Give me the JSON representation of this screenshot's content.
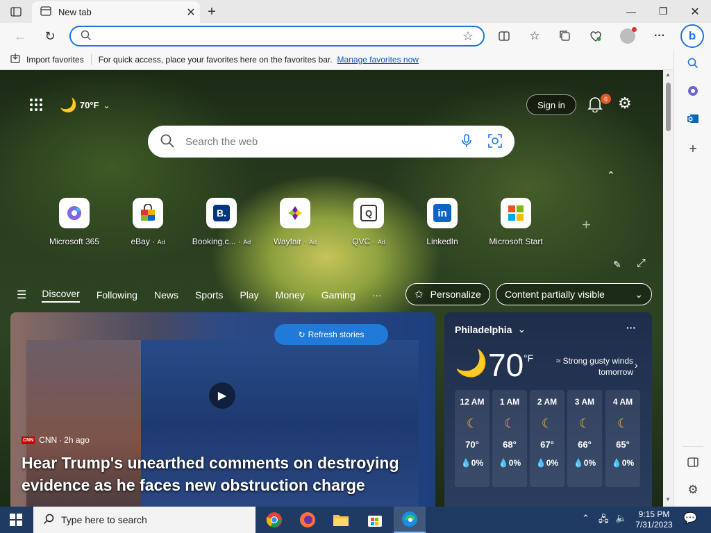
{
  "browser": {
    "tab_title": "New tab",
    "address_value": "",
    "favorites_bar": {
      "import_label": "Import favorites",
      "message": "For quick access, place your favorites here on the favorites bar.",
      "manage_link": "Manage favorites now"
    }
  },
  "newtab": {
    "weather_chip": "70°F",
    "sign_in": "Sign in",
    "notifications_count": "6",
    "search_placeholder": "Search the web",
    "quick_links": [
      {
        "label": "Microsoft 365",
        "ad": ""
      },
      {
        "label": "eBay",
        "ad": "Ad"
      },
      {
        "label": "Booking.c...",
        "ad": "Ad"
      },
      {
        "label": "Wayfair",
        "ad": "Ad"
      },
      {
        "label": "QVC",
        "ad": "Ad"
      },
      {
        "label": "LinkedIn",
        "ad": ""
      },
      {
        "label": "Microsoft Start",
        "ad": ""
      }
    ],
    "nav_tabs": [
      "Discover",
      "Following",
      "News",
      "Sports",
      "Play",
      "Money",
      "Gaming",
      "···"
    ],
    "personalize": "Personalize",
    "content_visibility": "Content partially visible",
    "hero": {
      "refresh": "Refresh stories",
      "source": "CNN",
      "age": "2h ago",
      "headline": "Hear Trump's unearthed comments on destroying evidence as he faces new obstruction charge"
    },
    "weather": {
      "city": "Philadelphia",
      "temp": "70",
      "unit": "°F",
      "forecast": "Strong gusty winds tomorrow",
      "hours": [
        {
          "hour": "12 AM",
          "temp": "70°",
          "precip": "0%"
        },
        {
          "hour": "1 AM",
          "temp": "68°",
          "precip": "0%"
        },
        {
          "hour": "2 AM",
          "temp": "67°",
          "precip": "0%"
        },
        {
          "hour": "3 AM",
          "temp": "66°",
          "precip": "0%"
        },
        {
          "hour": "4 AM",
          "temp": "65°",
          "precip": "0%"
        }
      ]
    }
  },
  "taskbar": {
    "search_placeholder": "Type here to search",
    "time": "9:15 PM",
    "date": "7/31/2023"
  }
}
